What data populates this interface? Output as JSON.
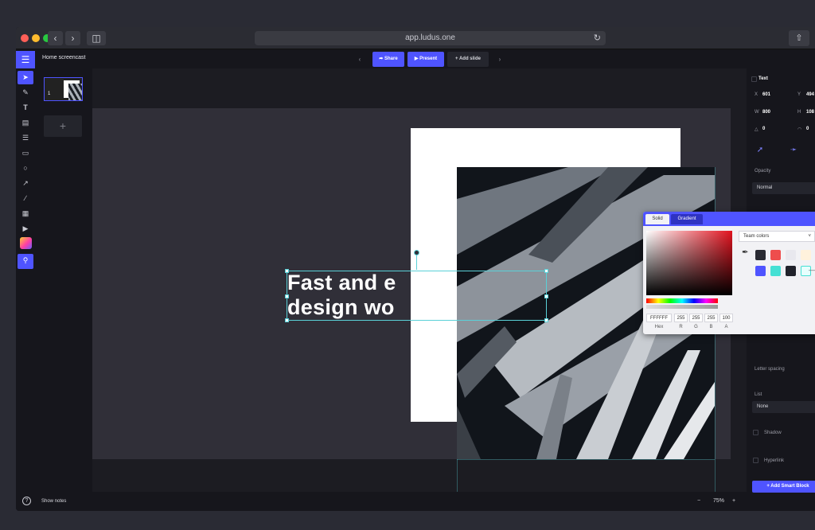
{
  "browser": {
    "url": "app.ludus.one"
  },
  "topbar": {
    "title": "Home screencast",
    "share_label": "Share",
    "present_label": "Present",
    "add_slide_label": "Add slide"
  },
  "slide": {
    "number": "1",
    "headline_line1": "Fast and e",
    "headline_line2": "design wo"
  },
  "bottom": {
    "show_notes_label": "Show notes",
    "zoom_value": "75%",
    "zoom_minus": "−",
    "zoom_plus": "+"
  },
  "inspector": {
    "section_title": "Text",
    "x_label": "X",
    "x_value": "601",
    "y_label": "Y",
    "y_value": "494",
    "w_label": "W",
    "w_value": "800",
    "h_label": "H",
    "h_value": "108",
    "rotation_value": "0",
    "radius_value": "0",
    "opacity_label": "Opacity",
    "blend_value": "Normal",
    "letter_spacing_label": "Letter spacing",
    "list_label": "List",
    "list_value": "None",
    "shadow_label": "Shadow",
    "hyperlink_label": "Hyperlink",
    "add_smart_block_label": "Add Smart Block"
  },
  "color_picker": {
    "tab_solid": "Solid",
    "tab_gradient": "Gradient",
    "hex_value": "FFFFFF",
    "r_value": "255",
    "g_value": "255",
    "b_value": "255",
    "a_value": "100",
    "hex_label": "Hex",
    "r_label": "R",
    "g_label": "G",
    "b_label": "B",
    "a_label": "A",
    "palette_select": "Team colors",
    "swatches": [
      "#2a2b33",
      "#ee4d4d",
      "#e8e8ee",
      "#fff2dc",
      "#4f54ff",
      "#45e0d4",
      "#22232b",
      "#e6fffd"
    ]
  },
  "colors": {
    "accent": "#4f54ff",
    "selection": "#5ad1d8"
  }
}
